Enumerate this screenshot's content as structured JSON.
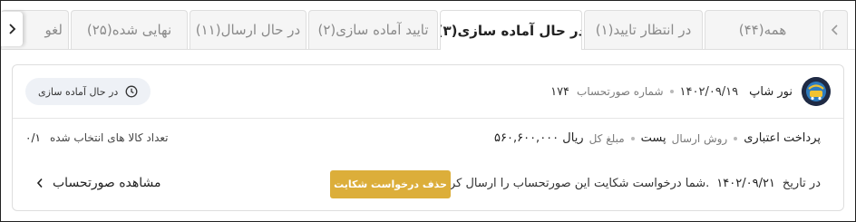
{
  "tabs": [
    {
      "label": "همه(۴۴)",
      "active": false
    },
    {
      "label": "در انتظار تایید(۱)",
      "active": false
    },
    {
      "label": "در حال آماده سازی(۳)",
      "active": true
    },
    {
      "label": "تایید آماده سازی(۲)",
      "active": false
    },
    {
      "label": "در حال ارسال(۱۱)",
      "active": false
    },
    {
      "label": "نهایی شده(۲۵)",
      "active": false
    },
    {
      "label": "لغو",
      "active": false
    }
  ],
  "tab_scroll": {
    "right_icon": "chevron-left-icon",
    "left_icon": "chevron-right-icon"
  },
  "order": {
    "shop_name": "نور شاپ",
    "shop_logo_icon": "shop-logo",
    "date": "۱۴۰۲/۰۹/۱۹",
    "invoice_label": "شماره صورتحساب",
    "invoice_number": "۱۷۴",
    "status": "در حال آماده سازی",
    "status_icon": "clock-icon",
    "payment_method": "پرداخت اعتباری",
    "shipping_label": "روش ارسال",
    "shipping_value": "پست",
    "total_label": "مبلغ کل",
    "total_value": "۵۶۰,۶۰۰,۰۰۰ ریال",
    "items_label": "تعداد کالا های انتخاب شده",
    "items_value": "۰/۱",
    "complaint_prefix": "در تاریخ",
    "complaint_date": "۱۴۰۲/۰۹/۲۱",
    "complaint_suffix": "شما درخواست شکایت این صورتحساب را ارسال کردید.",
    "delete_complaint_label": "حذف درخواست شکایت",
    "view_invoice_label": "مشاهده صورتحساب"
  },
  "colors": {
    "accent_button": "#dcae3a",
    "status_badge_bg": "#eef1f6",
    "tab_inactive_bg": "#f5f5f5",
    "border": "#dedede"
  }
}
